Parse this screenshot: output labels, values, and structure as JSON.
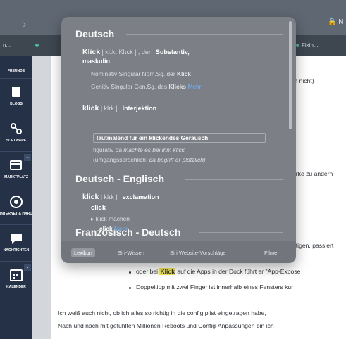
{
  "browser": {
    "back_symbol": "›",
    "url_right_text": "🔒 N",
    "tabs": [
      {
        "label": "n..."
      },
      {
        "label": ""
      },
      {
        "label": ""
      },
      {
        "label": ""
      },
      {
        "label": ""
      },
      {
        "label": ""
      },
      {
        "label": ""
      },
      {
        "label": ""
      },
      {
        "label": ""
      },
      {
        "label": "Fixin..."
      },
      {
        "label": ""
      }
    ]
  },
  "sidebar": {
    "items": [
      {
        "label": "FREUNDE",
        "icon": "friends-icon"
      },
      {
        "label": "BLOGS",
        "icon": "blog-icon"
      },
      {
        "label": "SOFTWARE",
        "icon": "software-icon"
      },
      {
        "label": "MARKTPLATZ",
        "icon": "market-icon"
      },
      {
        "label": "INTERNET & HARDWARE",
        "icon": "internet-icon"
      },
      {
        "label": "NACHRICHTEN",
        "icon": "message-icon"
      },
      {
        "label": "KALENDER",
        "icon": "calendar-icon"
      }
    ],
    "chevron": "⌄"
  },
  "page": {
    "line_top_right": "m nicht)",
    "line_mid_right": "ärke zu ändern",
    "line_lower_right": "ätigen, passiert",
    "bullet1_before": "oder bei ",
    "bullet1_highlight": "Klick",
    "bullet1_after": " auf die Apps in der Dock führt er \"App-Expose",
    "bullet2": "Doppeltipp mit zwei Finger ist innerhalb eines Fensters kur",
    "para1": "Ich weiß auch nicht, ob ich alles so richtig in die config.plist eingetragen habe,",
    "para2": "Nach und nach mit gefühlten Millionen Reboots und Config-Anpassungen bin ich"
  },
  "lookup": {
    "sections": [
      {
        "heading": "Deutsch"
      },
      {
        "heading": "Deutsch - Englisch"
      },
      {
        "heading": "Französisch - Deutsch"
      }
    ],
    "de1": {
      "word": "Klick",
      "pron": "| klɪk, Klɪck |",
      "article": ", der",
      "pos": "Substantiv,",
      "pos2": "maskulin",
      "gram1": "Nominativ Singular Nom.Sg. der",
      "gram1_word": "Klick",
      "gram2": "Genitiv Singular Gen.Sg. des",
      "gram2_word": "Klicks",
      "more": "Mehr"
    },
    "de2": {
      "word": "klick",
      "pron": "| klɪk |",
      "pos": "Interjektion",
      "sense": "lautmalend für ein klickendes Geräusch",
      "ex1_pre": "figurativ",
      "ex1": "da machte es bei ihm klick",
      "ex2_pre": "(umgangssprachlich;",
      "ex2": "da begriff er plötzlich)"
    },
    "en": {
      "word": "klick",
      "pron": "| klɪk |",
      "pos": "exclamation",
      "trans": "click",
      "sub_bullet": "▸ klick machen",
      "sub_trans": "click",
      "more": "Mehr"
    },
    "tabs": [
      {
        "label": "Lexikon",
        "active": true
      },
      {
        "label": "Siri-Wissen",
        "active": false
      },
      {
        "label": "Siri Website-Vorschläge",
        "active": false
      },
      {
        "label": "Filme",
        "active": false
      }
    ]
  }
}
